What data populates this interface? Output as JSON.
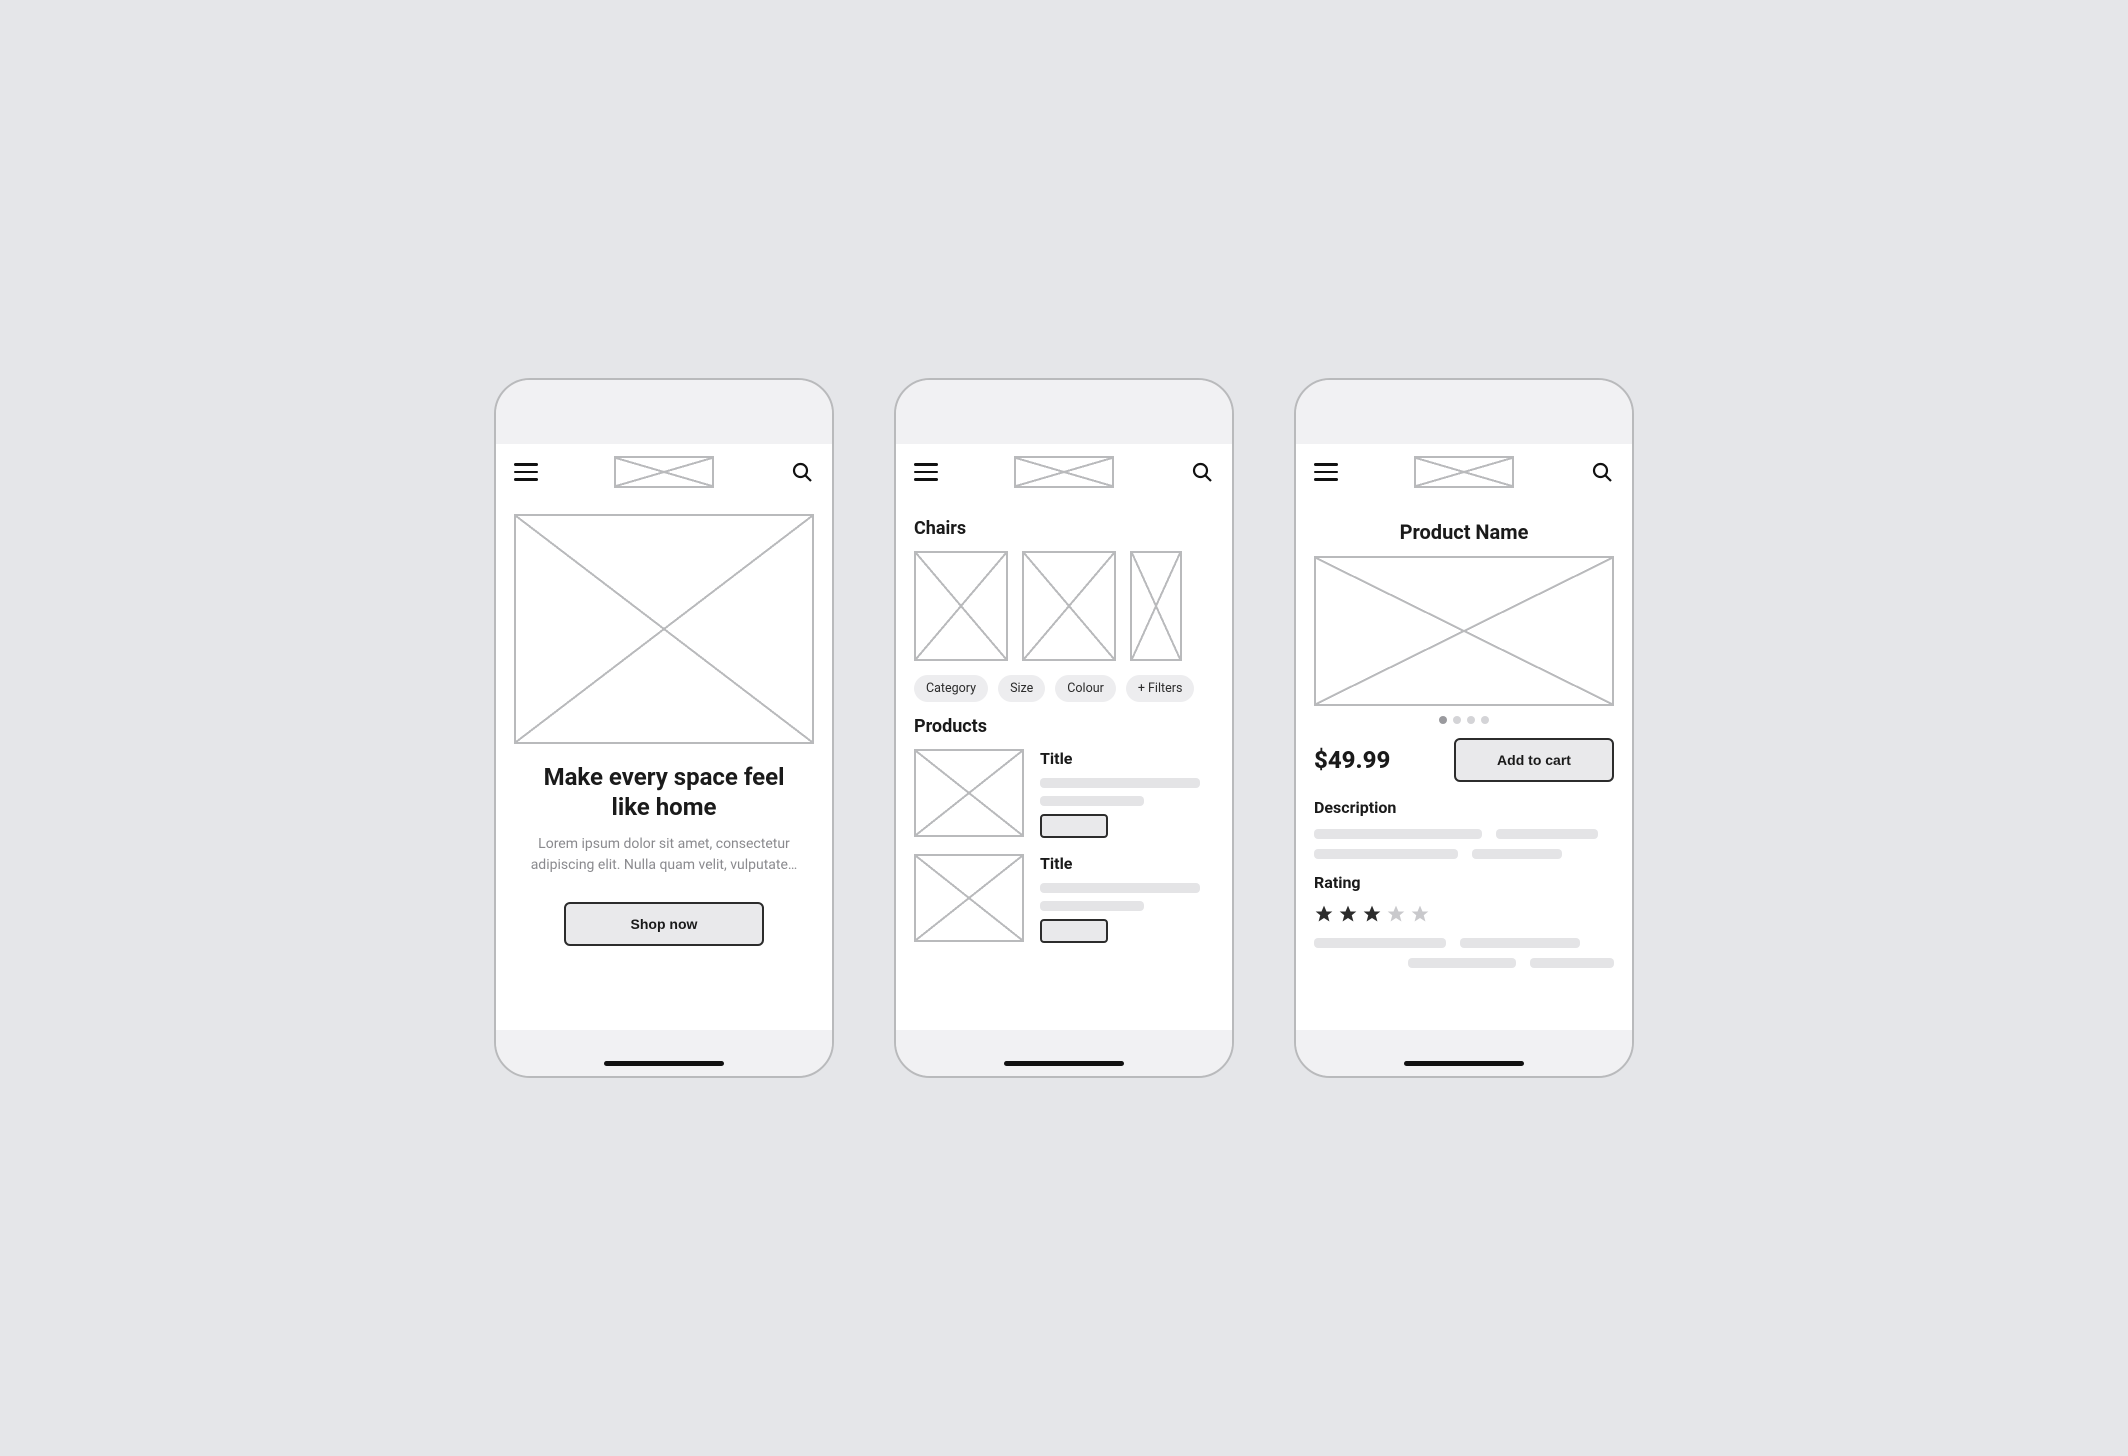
{
  "screens": {
    "home": {
      "hero_title": "Make every space feel like home",
      "hero_sub": "Lorem ipsum dolor sit amet, consectetur adipiscing elit. Nulla quam velit, vulputate…",
      "cta": "Shop now"
    },
    "category": {
      "title": "Chairs",
      "filters": [
        "Category",
        "Size",
        "Colour",
        "+ Filters"
      ],
      "products_heading": "Products",
      "products": [
        {
          "title": "Title"
        },
        {
          "title": "Title"
        }
      ]
    },
    "product": {
      "name": "Product Name",
      "price": "$49.99",
      "add_to_cart": "Add to cart",
      "description_label": "Description",
      "rating_label": "Rating",
      "rating_value": 3,
      "rating_max": 5,
      "carousel_count": 4,
      "carousel_active": 0
    }
  }
}
